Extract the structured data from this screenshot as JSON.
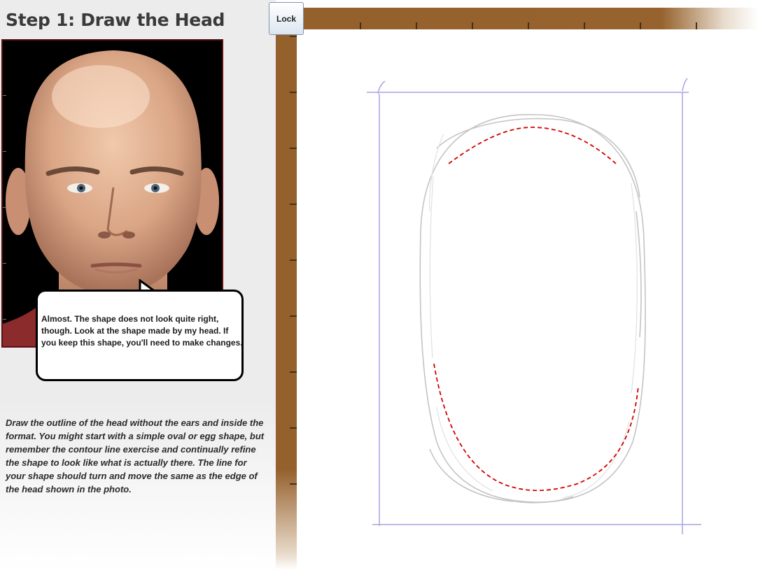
{
  "step": {
    "title": "Step 1: Draw the Head"
  },
  "feedback": {
    "message": "Almost. The shape does not look quite right, though. Look at the shape made by my head. If you keep this shape, you'll need to make changes."
  },
  "instructions": {
    "text": "Draw the outline of the head without the ears and inside the format. You might start with a simple oval or egg shape, but remember the contour line exercise and continually refine the shape to look like what is actually there. The line for your shape should turn and move the same as the edge of the head shown in the photo."
  },
  "toolbar": {
    "lock_label": "Lock"
  },
  "colors": {
    "ruler": "#94602c",
    "format_lines": "#a9a3e6",
    "sketch_lines": "#c4c4c4",
    "guide_dashes": "#d40000",
    "photo_border": "#5a0f0f"
  },
  "icons": {
    "portrait": "bald-man-portrait"
  }
}
